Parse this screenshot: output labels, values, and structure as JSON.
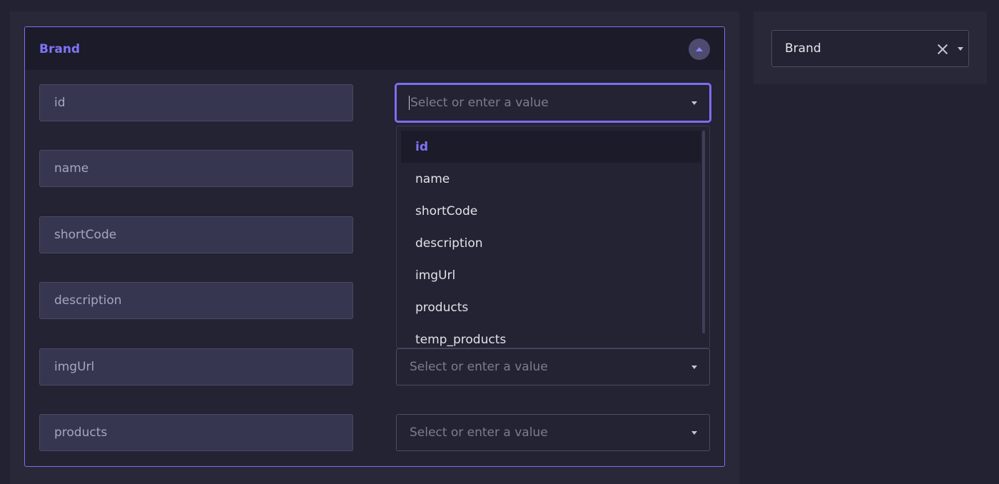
{
  "entity": {
    "title": "Brand"
  },
  "fields": [
    {
      "label": "id"
    },
    {
      "label": "name"
    },
    {
      "label": "shortCode"
    },
    {
      "label": "description"
    },
    {
      "label": "imgUrl"
    },
    {
      "label": "products"
    }
  ],
  "value_select": {
    "placeholder": "Select or enter a value"
  },
  "dropdown": {
    "options": [
      "id",
      "name",
      "shortCode",
      "description",
      "imgUrl",
      "products",
      "temp_products"
    ],
    "highlighted": "id"
  },
  "side_panel": {
    "selected": "Brand"
  },
  "colors": {
    "accent": "#7c6ef2",
    "background": "#222232",
    "panel": "#282838",
    "field": "#363650"
  }
}
